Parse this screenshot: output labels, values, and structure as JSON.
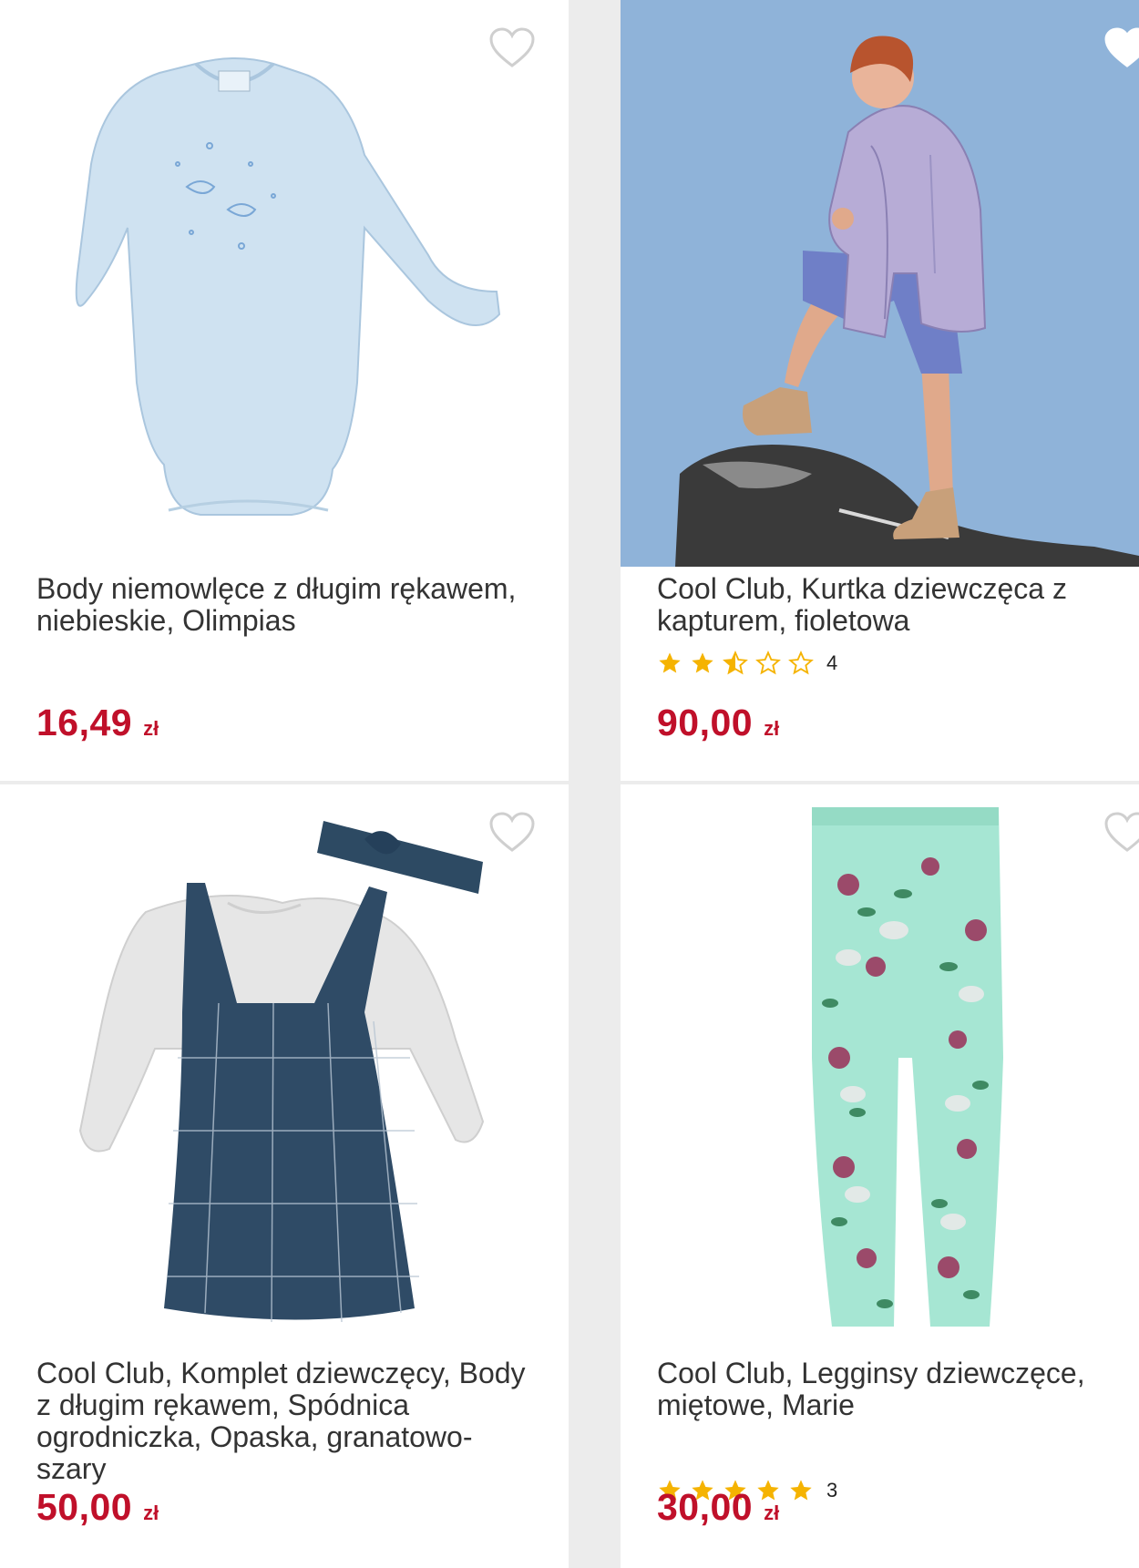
{
  "products": [
    {
      "title": "Body niemowlęce z długim rękawem, niebieskie, Olimpias",
      "price": "16,49",
      "currency": "zł",
      "image": "light-blue-baby-bodysuit",
      "favorite_icon": "heart-outline-icon"
    },
    {
      "title": "Cool Club, Kurtka dziewczęca z kapturem, fioletowa",
      "price": "90,00",
      "currency": "zł",
      "rating": 2.5,
      "rating_count": "4",
      "image": "girl-in-purple-puffer-jacket-on-rock",
      "favorite_icon": "heart-outline-icon"
    },
    {
      "title": "Cool Club, Komplet dziewczęcy, Body z długim rękawem, Spódnica ogrodniczka, Opaska, granatowo-szary",
      "price": "50,00",
      "currency": "zł",
      "image": "navy-plaid-dress-set-with-headband",
      "favorite_icon": "heart-outline-icon"
    },
    {
      "title": "Cool Club, Legginsy dziewczęce, miętowe, Marie",
      "price": "30,00",
      "currency": "zł",
      "rating": 5,
      "rating_count": "3",
      "image": "mint-floral-leggings",
      "favorite_icon": "heart-outline-icon"
    }
  ],
  "colors": {
    "price": "#c0102a",
    "star": "#f5b301",
    "background": "#ececec"
  }
}
